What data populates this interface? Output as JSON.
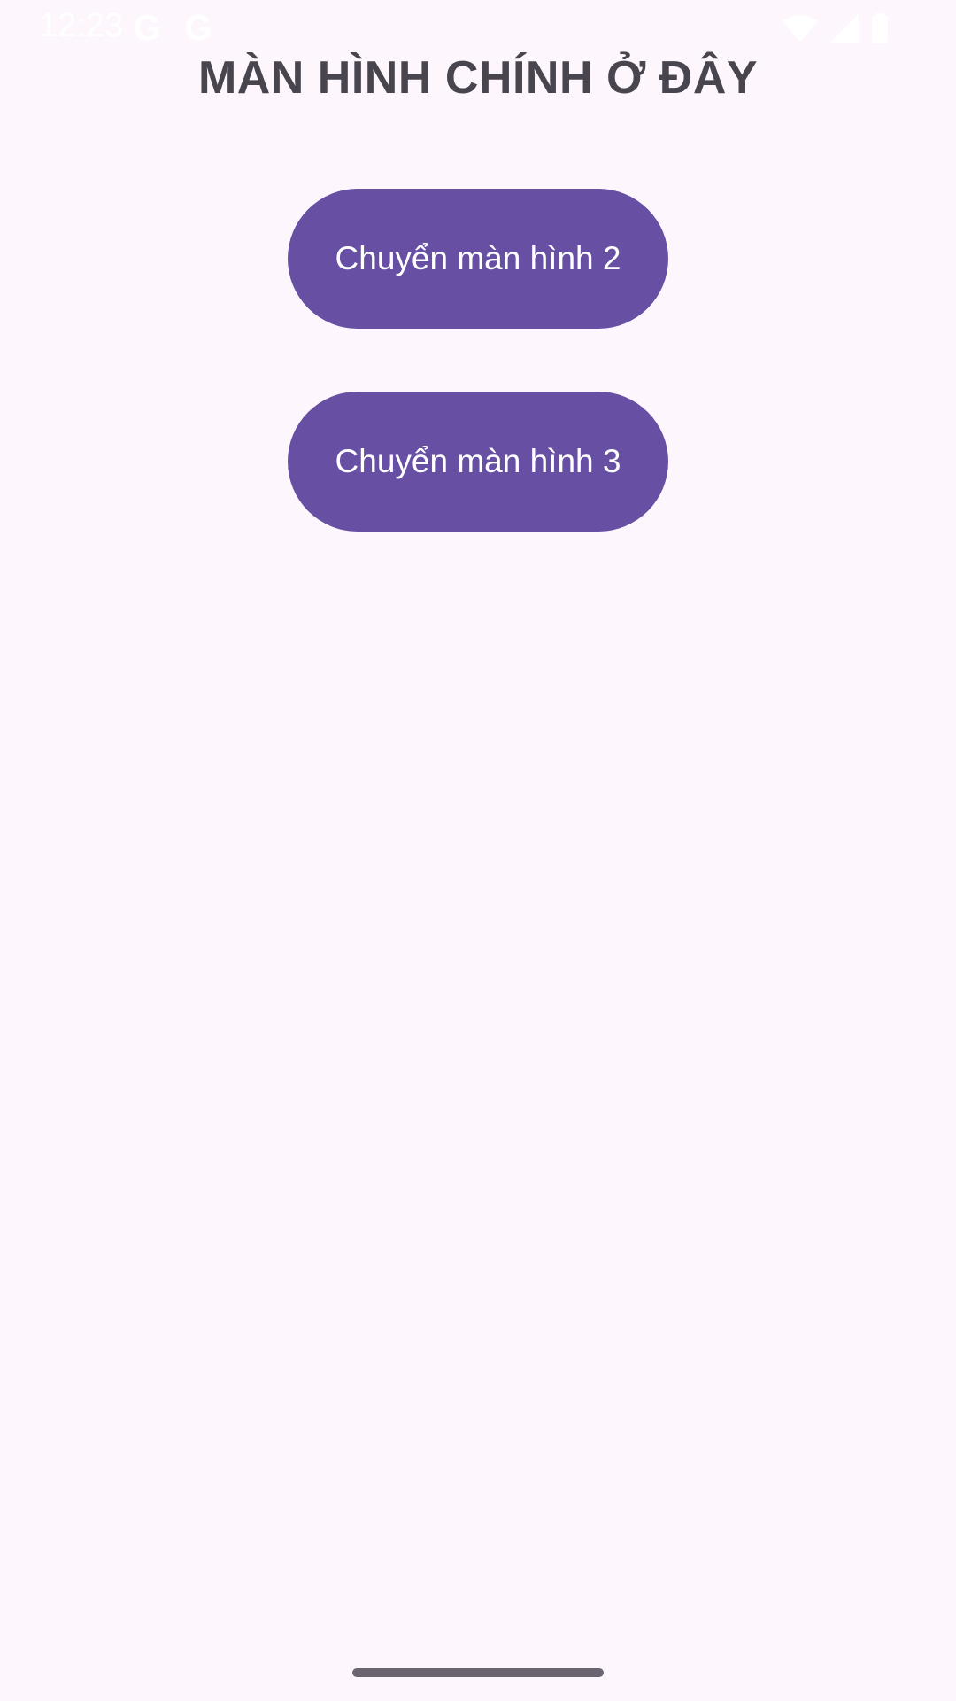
{
  "status_bar": {
    "time": "12:23",
    "notification_icons": [
      "google-g-icon",
      "google-g-icon"
    ],
    "system_icons": [
      "wifi-icon",
      "cell-signal-icon",
      "battery-icon"
    ],
    "icon_color": "#ffffff"
  },
  "main": {
    "title": "MÀN HÌNH CHÍNH Ở ĐÂY",
    "buttons": [
      {
        "label": "Chuyển màn hình 2"
      },
      {
        "label": "Chuyển màn hình 3"
      }
    ]
  },
  "colors": {
    "background": "#fdf7fd",
    "primary": "#6750a4",
    "title_text": "#49454f",
    "home_indicator": "#6a6570"
  }
}
